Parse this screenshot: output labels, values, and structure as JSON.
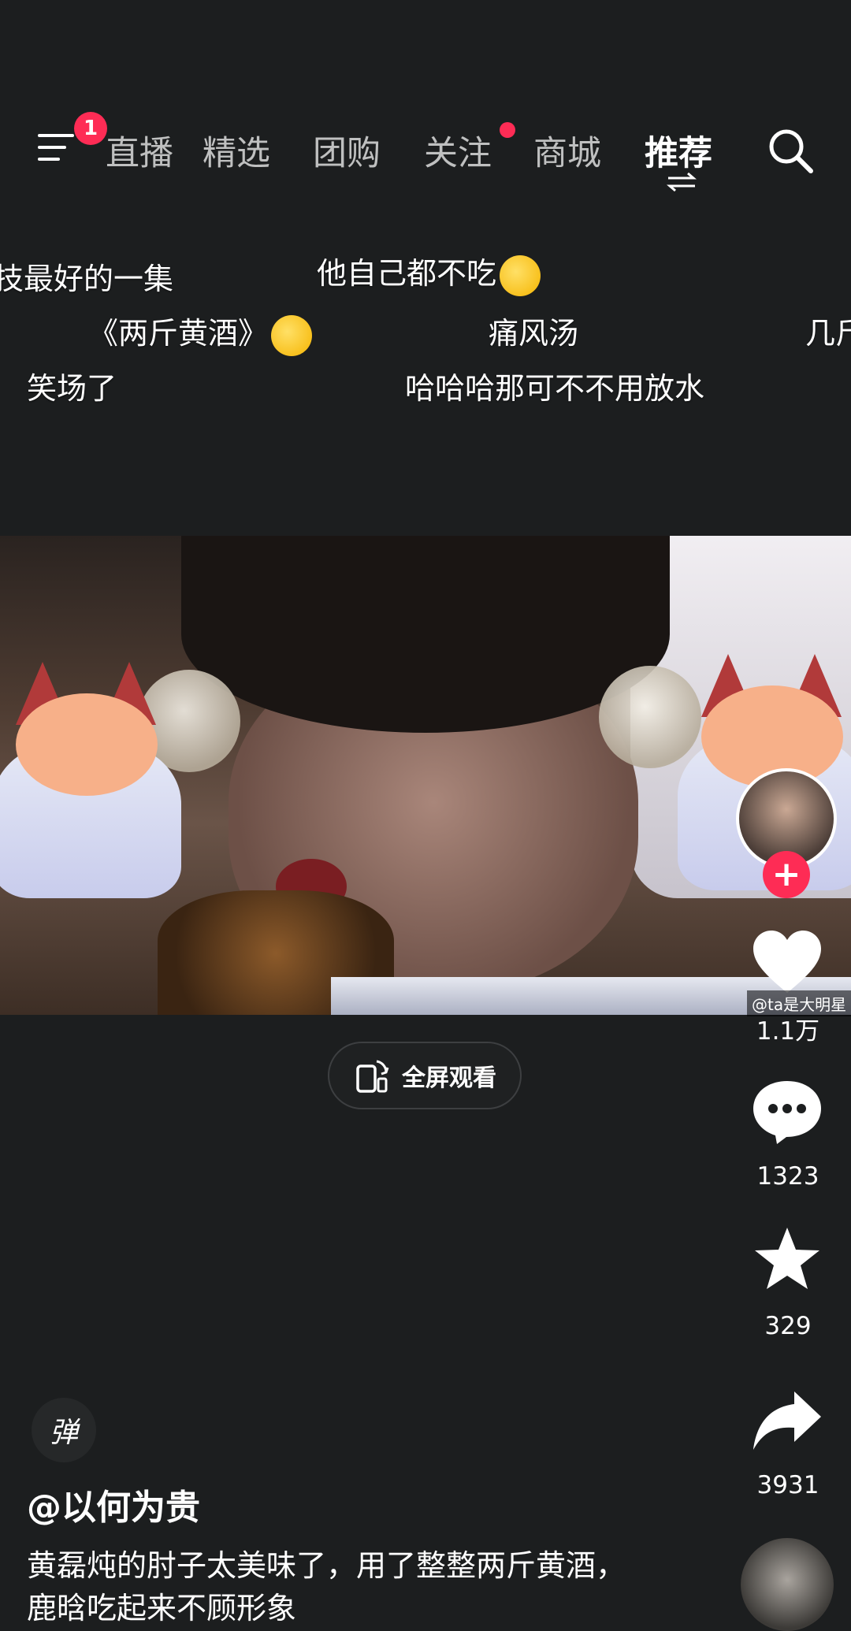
{
  "top_nav": {
    "menu_badge": "1",
    "tabs": [
      "直播",
      "精选",
      "团购",
      "关注",
      "商城",
      "推荐"
    ],
    "active_tab": "推荐"
  },
  "danmaku": [
    "技最好的一集",
    "他自己都不吃",
    "《两斤黄酒》",
    "痛风汤",
    "几斤",
    "笑场了",
    "哈哈哈那可不不用放水"
  ],
  "video": {
    "fullscreen_label": "全屏观看"
  },
  "right_rail": {
    "watermark": "@ta是大明星",
    "likes": "1.1万",
    "comments": "1323",
    "favorites": "329",
    "shares": "3931"
  },
  "bottom": {
    "danmaku_toggle": "弹",
    "author": "@以何为贵",
    "description": "黄磊炖的肘子太美味了，用了整整两斤黄酒，鹿晗吃起来不顾形象"
  },
  "colors": {
    "background": "#1c1e1f",
    "accent": "#fe2c55"
  }
}
